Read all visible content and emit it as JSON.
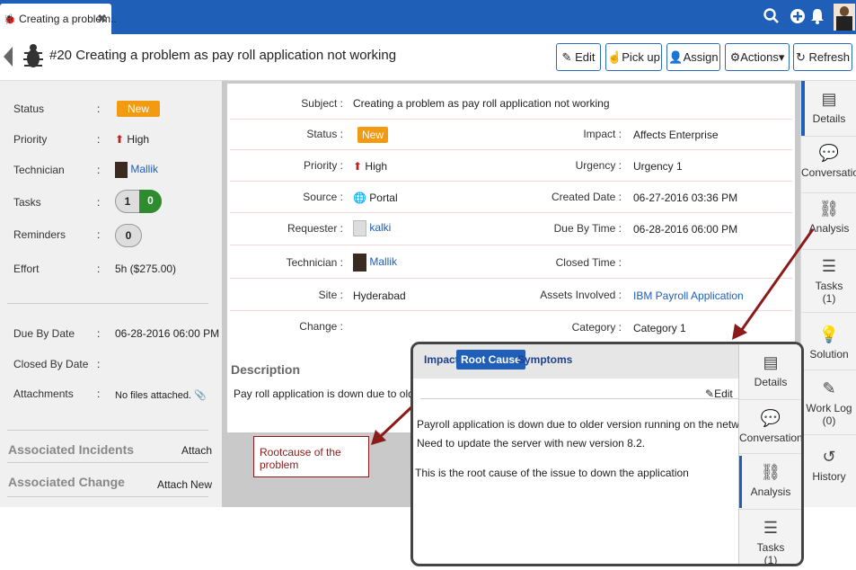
{
  "tab": {
    "title": "Creating a problem..",
    "close": "✖"
  },
  "topbar": {
    "icons": [
      "search-icon",
      "add-icon",
      "bell-icon",
      "user-avatar"
    ]
  },
  "header": {
    "title": "#20 Creating a problem as pay roll application not working",
    "buttons": {
      "edit": "Edit",
      "pickup": "Pick up",
      "assign": "Assign",
      "actions": "Actions",
      "refresh": "Refresh"
    }
  },
  "left": {
    "status_label": "Status",
    "status_value": "New",
    "priority_label": "Priority",
    "priority_value": "High",
    "technician_label": "Technician",
    "technician_value": "Mallik",
    "tasks_label": "Tasks",
    "tasks_total": "1",
    "tasks_done": "0",
    "reminders_label": "Reminders",
    "reminders_value": "0",
    "effort_label": "Effort",
    "effort_value": "5h ($275.00)",
    "due_label": "Due By Date",
    "due_value": "06-28-2016 06:00 PM",
    "closed_label": "Closed By Date",
    "attach_label": "Attachments",
    "attach_value": "No files attached.",
    "incidents_label": "Associated Incidents",
    "incidents_attach": "Attach",
    "change_label": "Associated Change",
    "change_attach": "Attach",
    "change_new": "New",
    "colon": ":"
  },
  "detail": {
    "subject_label": "Subject :",
    "subject_value": "Creating a problem as pay roll application not working",
    "status_label": "Status :",
    "status_value": "New",
    "impact_label": "Impact :",
    "impact_value": "Affects Enterprise",
    "priority_label": "Priority :",
    "priority_value": "High",
    "urgency_label": "Urgency :",
    "urgency_value": "Urgency 1",
    "source_label": "Source :",
    "source_value": "Portal",
    "created_label": "Created Date :",
    "created_value": "06-27-2016 03:36 PM",
    "requester_label": "Requester :",
    "requester_value": "kalki",
    "dueby_label": "Due By Time :",
    "dueby_value": "06-28-2016 06:00 PM",
    "technician_label": "Technician :",
    "technician_value": "Mallik",
    "closed_label": "Closed Time :",
    "site_label": "Site :",
    "site_value": "Hyderabad",
    "assets_label": "Assets Involved :",
    "assets_value": "IBM Payroll Application",
    "change_label": "Change :",
    "category_label": "Category :",
    "category_value": "Category 1",
    "description_title": "Description",
    "description_text": "Pay roll application is down due to older ver"
  },
  "rightnav": [
    {
      "label": "Details",
      "icon": "details-icon"
    },
    {
      "label": "Conversations",
      "icon": "chat-icon"
    },
    {
      "label": "Analysis",
      "icon": "analysis-icon"
    },
    {
      "label": "Tasks",
      "sub": "(1)",
      "icon": "tasks-icon"
    },
    {
      "label": "Solution",
      "icon": "bulb-icon"
    },
    {
      "label": "Work Log",
      "sub": "(0)",
      "icon": "pencil-icon"
    },
    {
      "label": "History",
      "icon": "history-icon"
    }
  ],
  "callout": {
    "text": "Rootcause of the problem"
  },
  "zoom": {
    "tabs": {
      "impact": "Impact",
      "rootcause": "Root Cause",
      "symptoms": "Symptoms"
    },
    "edit": "Edit",
    "line1": "Payroll application is down due to older version running on the network.",
    "line2": "Need to update the server with new version 8.2.",
    "line3": "This is the root cause of the issue to down the application",
    "nav": [
      {
        "label": "Details"
      },
      {
        "label": "Conversation"
      },
      {
        "label": "Analysis"
      },
      {
        "label": "Tasks"
      }
    ],
    "nav_tasks_sub": "(1)"
  },
  "colors": {
    "brand": "#1f5fb8",
    "new_badge": "#f29a12",
    "callout": "#8b1a1a"
  }
}
